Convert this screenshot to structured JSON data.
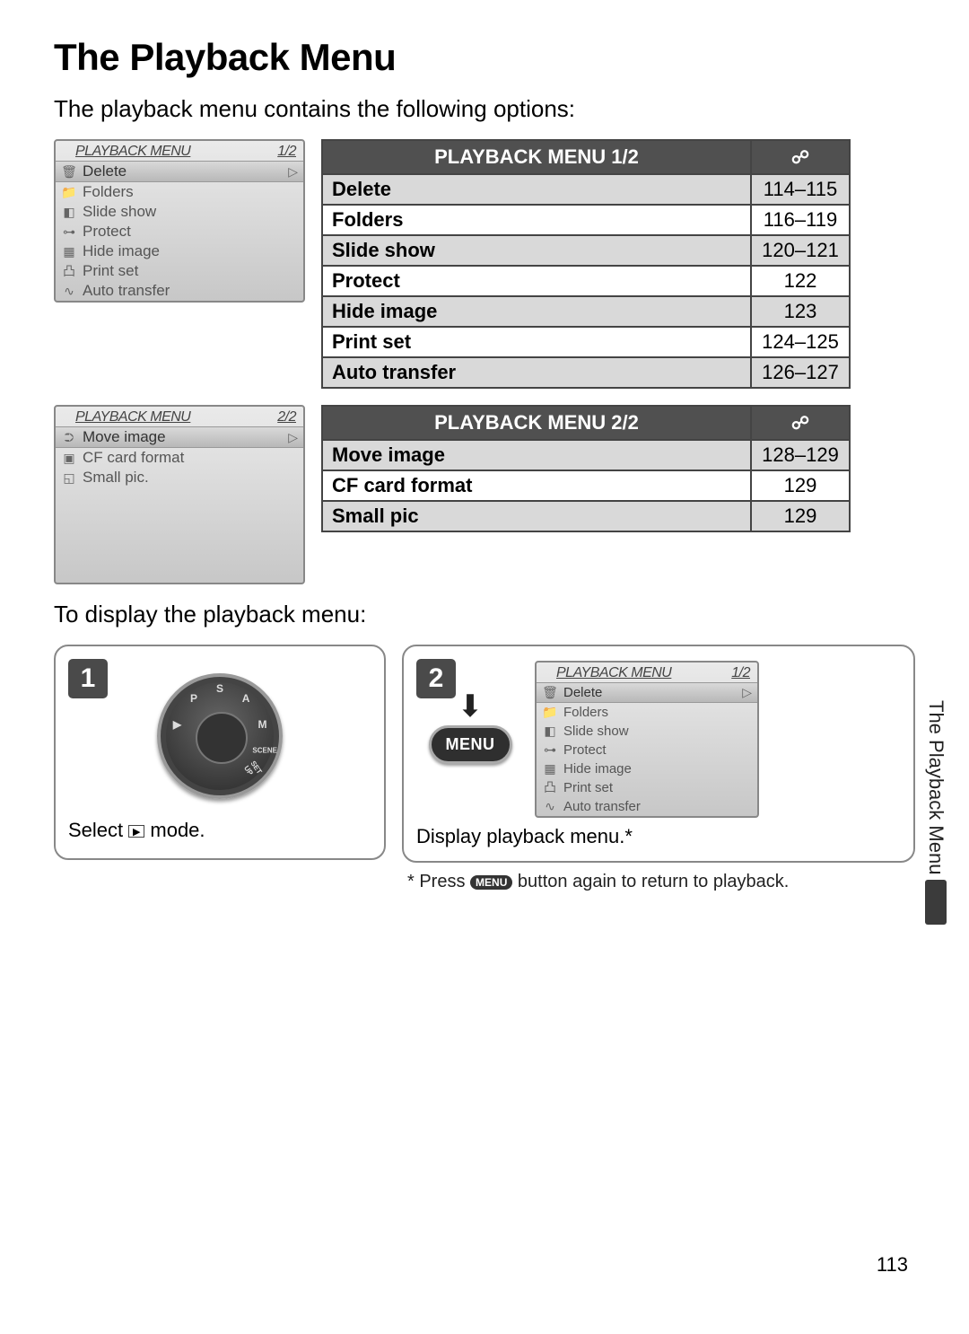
{
  "title": "The Playback Menu",
  "intro": "The playback menu contains the following options:",
  "lcd1": {
    "title": "PLAYBACK MENU",
    "page": "1/2",
    "items": [
      {
        "icon": "🗑",
        "label": "Delete",
        "selected": true
      },
      {
        "icon": "📁",
        "label": "Folders"
      },
      {
        "icon": "◧",
        "label": "Slide show"
      },
      {
        "icon": "⊶",
        "label": "Protect"
      },
      {
        "icon": "▦",
        "label": "Hide image"
      },
      {
        "icon": "凸",
        "label": "Print set"
      },
      {
        "icon": "∿",
        "label": "Auto transfer"
      }
    ]
  },
  "table1": {
    "header": "PLAYBACK MENU 1/2",
    "page_icon": "☍",
    "rows": [
      {
        "name": "Delete",
        "pages": "114–115"
      },
      {
        "name": "Folders",
        "pages": "116–119"
      },
      {
        "name": "Slide show",
        "pages": "120–121"
      },
      {
        "name": "Protect",
        "pages": "122"
      },
      {
        "name": "Hide image",
        "pages": "123"
      },
      {
        "name": "Print set",
        "pages": "124–125"
      },
      {
        "name": "Auto transfer",
        "pages": "126–127"
      }
    ]
  },
  "lcd2": {
    "title": "PLAYBACK MENU",
    "page": "2/2",
    "items": [
      {
        "icon": "⮊",
        "label": "Move image",
        "selected": true
      },
      {
        "icon": "▣",
        "label": "CF card format"
      },
      {
        "icon": "◱",
        "label": "Small pic."
      }
    ]
  },
  "table2": {
    "header": "PLAYBACK MENU 2/2",
    "page_icon": "☍",
    "rows": [
      {
        "name": "Move image",
        "pages": "128–129"
      },
      {
        "name": "CF card format",
        "pages": "129"
      },
      {
        "name": "Small pic",
        "pages": "129"
      }
    ]
  },
  "subintro": "To display the playback menu:",
  "step1": {
    "num": "1",
    "caption_pre": "Select ",
    "caption_post": " mode."
  },
  "step2": {
    "num": "2",
    "menu_label": "MENU",
    "caption": "Display playback menu.*"
  },
  "footnote_pre": "* Press ",
  "footnote_btn": "MENU",
  "footnote_post": " button again to return to play­back.",
  "side_tab": "The Playback Menu",
  "page_number": "113"
}
